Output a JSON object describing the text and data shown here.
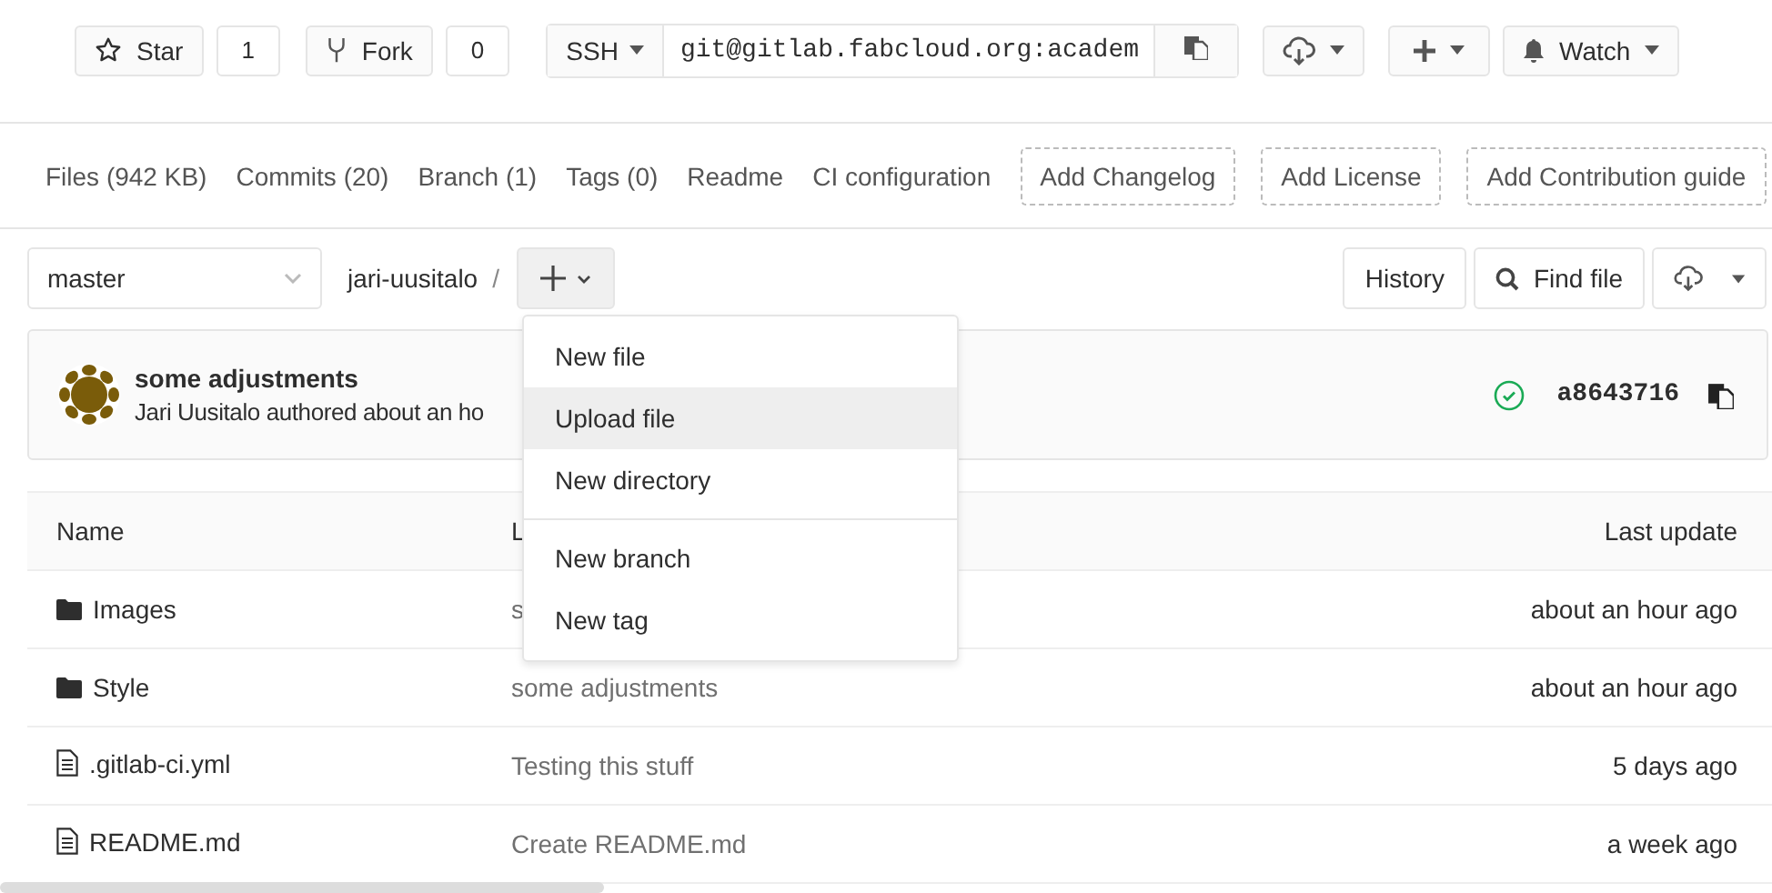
{
  "header": {
    "star": {
      "label": "Star",
      "count": "1"
    },
    "fork": {
      "label": "Fork",
      "count": "0"
    },
    "clone": {
      "protocol": "SSH",
      "url": "git@gitlab.fabcloud.org:academ"
    },
    "watch": {
      "label": "Watch"
    }
  },
  "nav": {
    "links": [
      "Files (942 KB)",
      "Commits (20)",
      "Branch (1)",
      "Tags (0)",
      "Readme",
      "CI configuration"
    ],
    "buttons": [
      "Add Changelog",
      "Add License",
      "Add Contribution guide"
    ]
  },
  "toolbar": {
    "branch": "master",
    "path": "jari-uusitalo",
    "separator": "/",
    "actions": [
      "History",
      "Find file"
    ]
  },
  "commit": {
    "title": "some adjustments",
    "meta": "Jari Uusitalo authored about an ho",
    "pipeline_passed": true,
    "sha": "a8643716"
  },
  "dropdown": {
    "groups": [
      [
        {
          "label": "New file",
          "selected": false
        },
        {
          "label": "Upload file",
          "selected": true
        },
        {
          "label": "New directory",
          "selected": false
        }
      ],
      [
        {
          "label": "New branch",
          "selected": false
        },
        {
          "label": "New tag",
          "selected": false
        }
      ]
    ]
  },
  "table": {
    "columns": [
      "Name",
      "L",
      "Last update"
    ],
    "rows": [
      {
        "kind": "folder",
        "name": "Images",
        "message": "s",
        "updated": "about an hour ago"
      },
      {
        "kind": "folder",
        "name": "Style",
        "message": "some adjustments",
        "updated": "about an hour ago"
      },
      {
        "kind": "file",
        "name": ".gitlab-ci.yml",
        "message": "Testing this stuff",
        "updated": "5 days ago"
      },
      {
        "kind": "file",
        "name": "README.md",
        "message": "Create README.md",
        "updated": "a week ago"
      }
    ]
  }
}
